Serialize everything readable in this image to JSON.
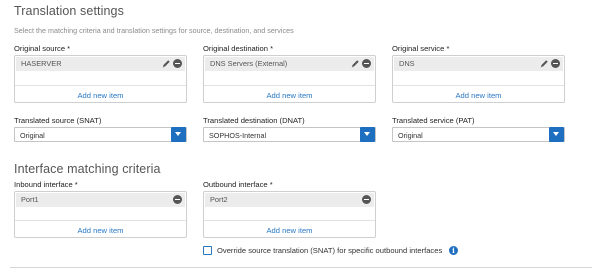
{
  "translation": {
    "title": "Translation settings",
    "subtitle": "Select the matching criteria and translation settings for source, destination, and services",
    "original_source": {
      "label": "Original source *",
      "item": "HASERVER",
      "add_label": "Add new item"
    },
    "original_destination": {
      "label": "Original destination *",
      "item": "DNS Servers (External)",
      "add_label": "Add new item"
    },
    "original_service": {
      "label": "Original service *",
      "item": "DNS",
      "add_label": "Add new item"
    },
    "translated_source": {
      "label": "Translated source (SNAT)",
      "value": "Original"
    },
    "translated_destination": {
      "label": "Translated destination (DNAT)",
      "value": "SOPHOS-Internal"
    },
    "translated_service": {
      "label": "Translated service (PAT)",
      "value": "Original"
    }
  },
  "interface": {
    "title": "Interface matching criteria",
    "inbound": {
      "label": "Inbound interface *",
      "item": "Port1",
      "add_label": "Add new item"
    },
    "outbound": {
      "label": "Outbound interface *",
      "item": "Port2",
      "add_label": "Add new item"
    },
    "override_label": "Override source translation (SNAT) for specific outbound interfaces",
    "override_checked": false,
    "info_glyph": "i"
  },
  "colors": {
    "accent": "#1e6fc0",
    "link": "#2a78c2",
    "item_bg": "#ececec"
  }
}
